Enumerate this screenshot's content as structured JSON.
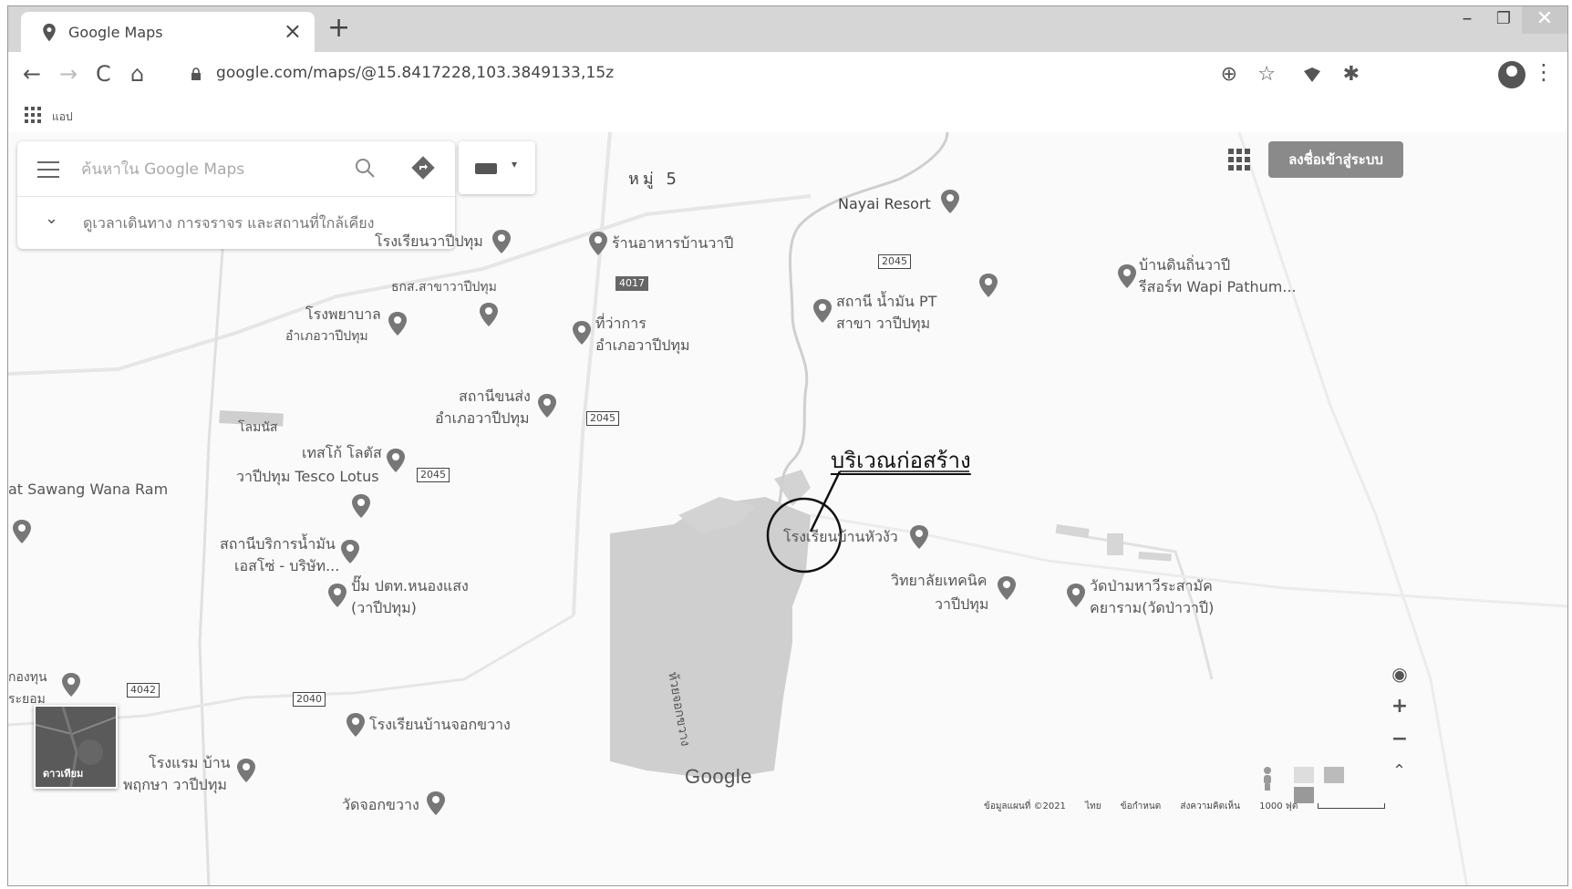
{
  "browser": {
    "tab_title": "Google Maps",
    "tab_close": "×",
    "new_tab": "+",
    "window": {
      "minimize": "–",
      "maximize": "❐",
      "close": "✕"
    },
    "nav": {
      "back": "←",
      "forward": "→",
      "reload": "C",
      "home": "⌂"
    },
    "url": "google.com/maps/@15.8417228,103.3849133,15z",
    "toolbar_icons": {
      "add": "⊕",
      "star": "☆",
      "extension": "✱",
      "menu": "⋮"
    },
    "bookmarks_apps_label": "แอป"
  },
  "maps": {
    "search_placeholder": "ค้นหาใน Google Maps",
    "expand_text": "ดูเวลาเดินทาง การจราจร และสถานที่ใกล้เคียง",
    "signin_label": "ลงชื่อเข้าสู่ระบบ",
    "satellite_label": "ดาวเทียม",
    "google_logo": "Google",
    "zoom_in": "+",
    "zoom_out": "−",
    "footer": {
      "data": "ข้อมูลแผนที่ ©2021",
      "lang": "ไทย",
      "terms": "ข้อกำหนด",
      "feedback": "ส่งความคิดเห็น",
      "scale": "1000 ฟุต"
    },
    "annotation": "บริเวณก่อสร้าง",
    "places": [
      "หมู่ 5",
      "Nayai Resort",
      "โรงเรียนวาปีปทุม",
      "ร้านอาหารบ้านวาปี",
      "ธกส.สาขาวาปีปทุม",
      "โรงพยาบาล",
      "อำเภอวาปีปทุม",
      "ที่ว่าการ",
      "อำเภอวาปีปทุม",
      "สถานี น้ำมัน PT",
      "สาขา วาปีปทุม",
      "บ้านดินถิ่นวาปี",
      "รีสอร์ท Wapi Pathum...",
      "สถานีขนส่ง",
      "อำเภอวาปีปทุม",
      "โลมนัส",
      "เทสโก้ โลตัส",
      "วาปีปทุม Tesco Lotus",
      "at Sawang Wana Ram",
      "สถานีบริการน้ำมัน",
      "เอสโซ่ - บริษัท...",
      "ปั๊ม ปตท.หนองแสง",
      "(วาปีปทุม)",
      "โรงเรียนบ้านหัวงัว",
      "วิทยาลัยเทคนิค",
      "วาปีปทุม",
      "วัดป่ามหาวีระสามัค",
      "คยาราม(วัดป่าวาปี)",
      "ห้วยจอกขวาง",
      "กองทุน",
      "ระยอม",
      "โรงเรียนบ้านจอกขวาง",
      "โรงแรม บ้าน",
      "พฤกษา วาปีปทุม",
      "วัดจอกขวาง"
    ],
    "road_shields": [
      "2045",
      "4017",
      "2045",
      "2045",
      "4042",
      "2040"
    ]
  }
}
